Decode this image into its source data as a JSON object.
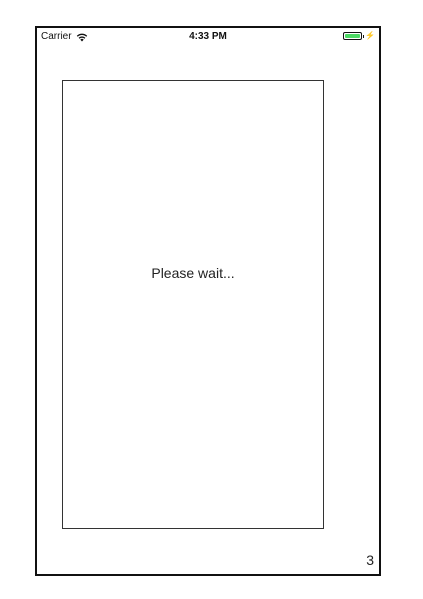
{
  "status_bar": {
    "carrier": "Carrier",
    "time": "4:33 PM",
    "battery_level": 1.0,
    "battery_color": "#4cd964"
  },
  "content": {
    "message": "Please wait..."
  },
  "footer": {
    "page_number": "3"
  },
  "icons": [
    "wifi-icon",
    "battery-icon",
    "charging-bolt-icon"
  ]
}
